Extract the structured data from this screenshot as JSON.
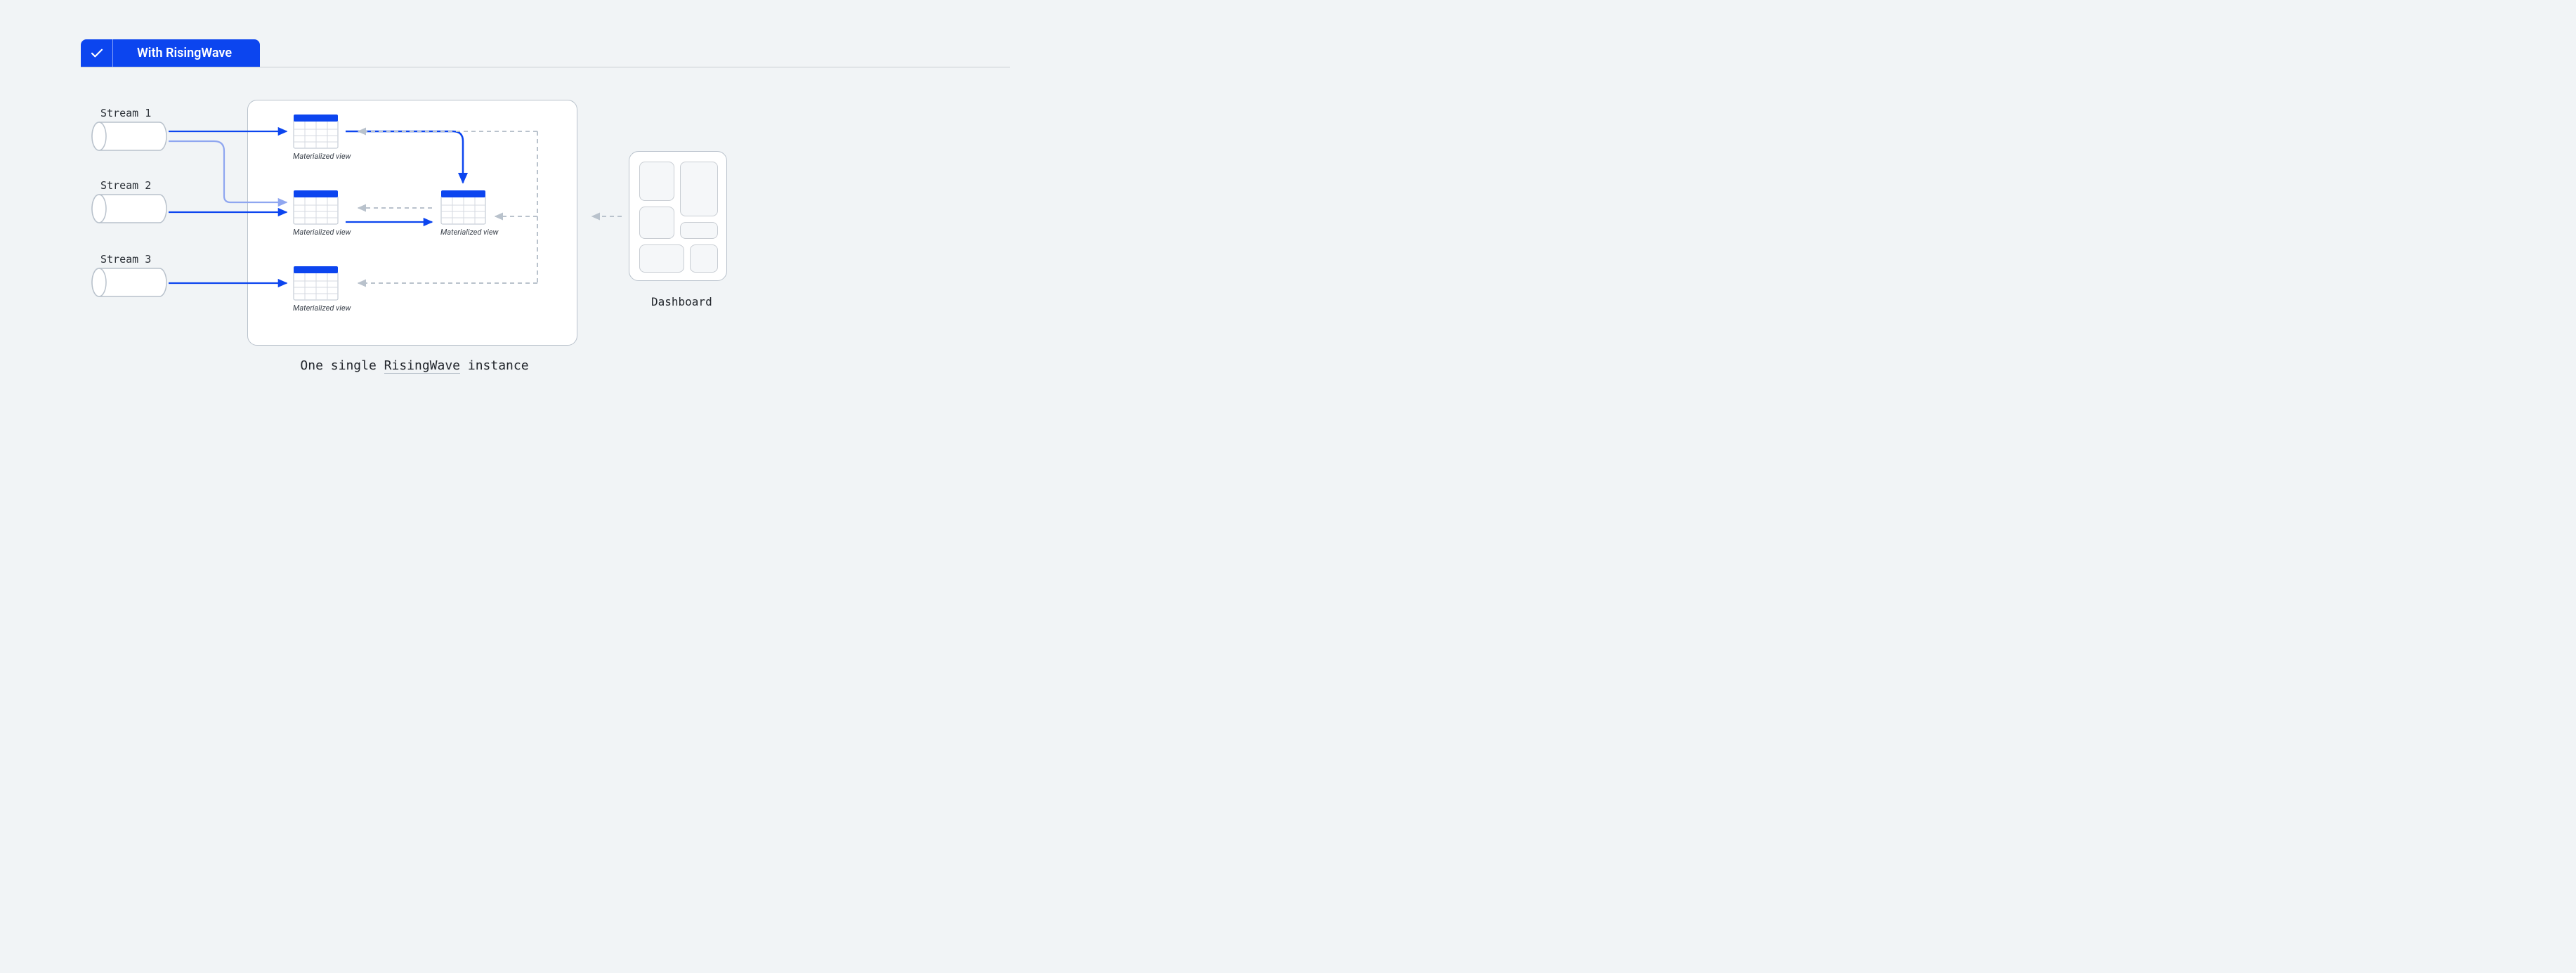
{
  "tab": {
    "title": "With RisingWave"
  },
  "streams": [
    {
      "label": "Stream 1"
    },
    {
      "label": "Stream 2"
    },
    {
      "label": "Stream 3"
    }
  ],
  "mvLabel": "Materialized view",
  "instanceCaption": {
    "pre": "One single ",
    "underlined": "RisingWave",
    "post": " instance"
  },
  "dashboard": {
    "label": "Dashboard"
  },
  "colors": {
    "accent": "#0C45EF",
    "muted": "#b9c2cc",
    "accentSoft": "#8fa6f0"
  }
}
